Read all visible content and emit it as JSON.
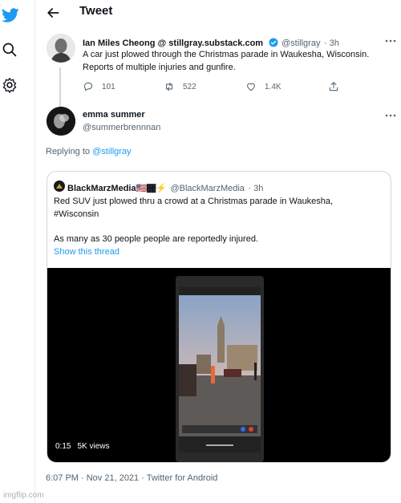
{
  "app": {
    "brand_color": "#1d9bf0"
  },
  "sidebar": {
    "icons": [
      "twitter-bird-icon",
      "search-icon",
      "settings-icon"
    ]
  },
  "header": {
    "title": "Tweet"
  },
  "tweet1": {
    "author": "Ian Miles Cheong @ stillgray.substack.com",
    "verified": true,
    "handle": "@stillgray",
    "time": "· 3h",
    "text_line1": "A car just plowed through the Christmas parade in Waukesha, Wisconsin.",
    "text_line2": "Reports of multiple injuries and gunfire.",
    "actions": {
      "replies": "101",
      "retweets": "522",
      "likes": "1.4K"
    }
  },
  "tweet2": {
    "author": "emma summer",
    "handle": "@summerbrennnan",
    "replying_prefix": "Replying to",
    "replying_handle": "@stillgray"
  },
  "quote": {
    "author": "BlackMarzMedia🇺🇸🏾⚡",
    "handle": "@BlackMarzMedia",
    "time": "· 3h",
    "text_line1": "Red SUV just plowed thru a crowd at a Christmas parade in Waukesha,",
    "text_line2": "#Wisconsin",
    "text_line3": "As many as 30 people people are reportedly injured.",
    "show_thread": "Show this thread",
    "video": {
      "duration": "0:15",
      "views": "5K views"
    }
  },
  "footer": {
    "timestamp": "6:07 PM · Nov 21, 2021 · Twitter for Android"
  },
  "watermark": "imgflip.com"
}
